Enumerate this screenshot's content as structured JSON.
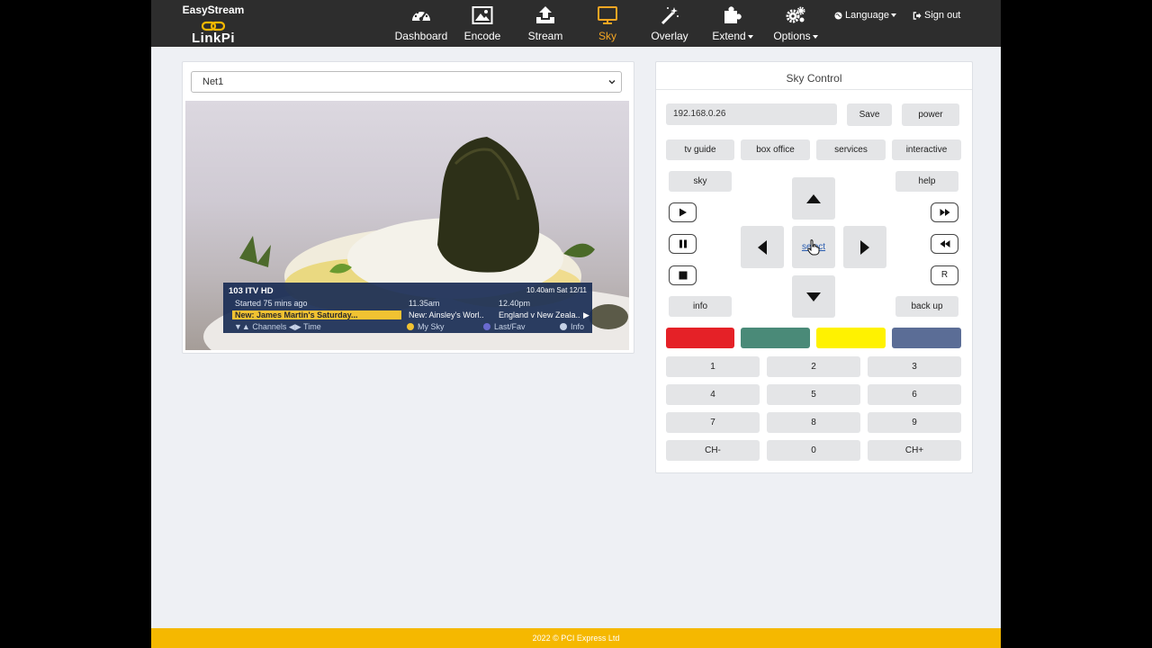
{
  "brand": {
    "line1": "EasyStream",
    "line2": "LinkPi"
  },
  "nav": {
    "items": [
      {
        "label": "Dashboard",
        "icon": "speedometer-icon"
      },
      {
        "label": "Encode",
        "icon": "image-icon"
      },
      {
        "label": "Stream",
        "icon": "upload-icon"
      },
      {
        "label": "Sky",
        "icon": "monitor-icon",
        "active": true
      },
      {
        "label": "Overlay",
        "icon": "magic-wand-icon"
      },
      {
        "label": "Extend",
        "icon": "puzzle-icon"
      },
      {
        "label": "Options",
        "icon": "gears-icon"
      }
    ],
    "language": "Language",
    "signout": "Sign out"
  },
  "video": {
    "source_select": "Net1",
    "osd": {
      "channel": "103 ITV HD",
      "datetime": "10.40am Sat 12/11",
      "started": "Started 75 mins ago",
      "time2": "11.35am",
      "time3": "12.40pm",
      "prog1": "New: James Martin's Saturday...",
      "prog2": "New: Ainsley's Worl..",
      "prog3": "England v New Zeala..",
      "hint_channels": "Channels",
      "hint_time": "Time",
      "hint_mysky": "My Sky",
      "hint_lastfav": "Last/Fav",
      "hint_info": "Info"
    }
  },
  "control": {
    "title": "Sky Control",
    "ip": "192.168.0.26",
    "save": "Save",
    "power": "power",
    "tv_guide": "tv guide",
    "box_office": "box office",
    "services": "services",
    "interactive": "interactive",
    "sky": "sky",
    "help": "help",
    "select": "select",
    "info": "info",
    "back_up": "back up",
    "record": "R",
    "colors": [
      "#e52127",
      "#4a8a78",
      "#fff200",
      "#5b6d96"
    ],
    "numpad": [
      "1",
      "2",
      "3",
      "4",
      "5",
      "6",
      "7",
      "8",
      "9",
      "CH-",
      "0",
      "CH+"
    ]
  },
  "footer": "2022 © PCI Express Ltd",
  "accent": "#f5a623"
}
